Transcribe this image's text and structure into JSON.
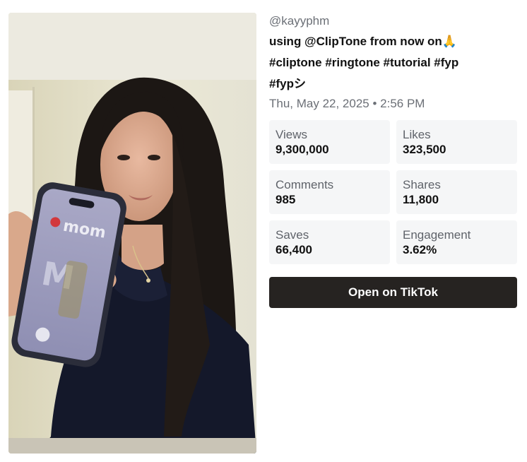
{
  "video": {
    "thumbnail_alt": "video-thumbnail",
    "phone_screen_text": "mom",
    "phone_screen_letter": "M"
  },
  "post": {
    "handle": "@kayyphm",
    "caption_line1": "using @ClipTone from now on🙏",
    "caption_line2": "#cliptone #ringtone #tutorial #fyp",
    "caption_line3": "#fypシ",
    "date": "Thu, May 22, 2025 • 2:56 PM"
  },
  "stats": [
    {
      "label": "Views",
      "value": "9,300,000"
    },
    {
      "label": "Likes",
      "value": "323,500"
    },
    {
      "label": "Comments",
      "value": "985"
    },
    {
      "label": "Shares",
      "value": "11,800"
    },
    {
      "label": "Saves",
      "value": "66,400"
    },
    {
      "label": "Engagement",
      "value": "3.62%"
    }
  ],
  "actions": {
    "open_label": "Open on TikTok"
  },
  "colors": {
    "button_bg": "#262321",
    "stat_bg": "#f5f6f7",
    "muted_text": "#6b6f76"
  }
}
